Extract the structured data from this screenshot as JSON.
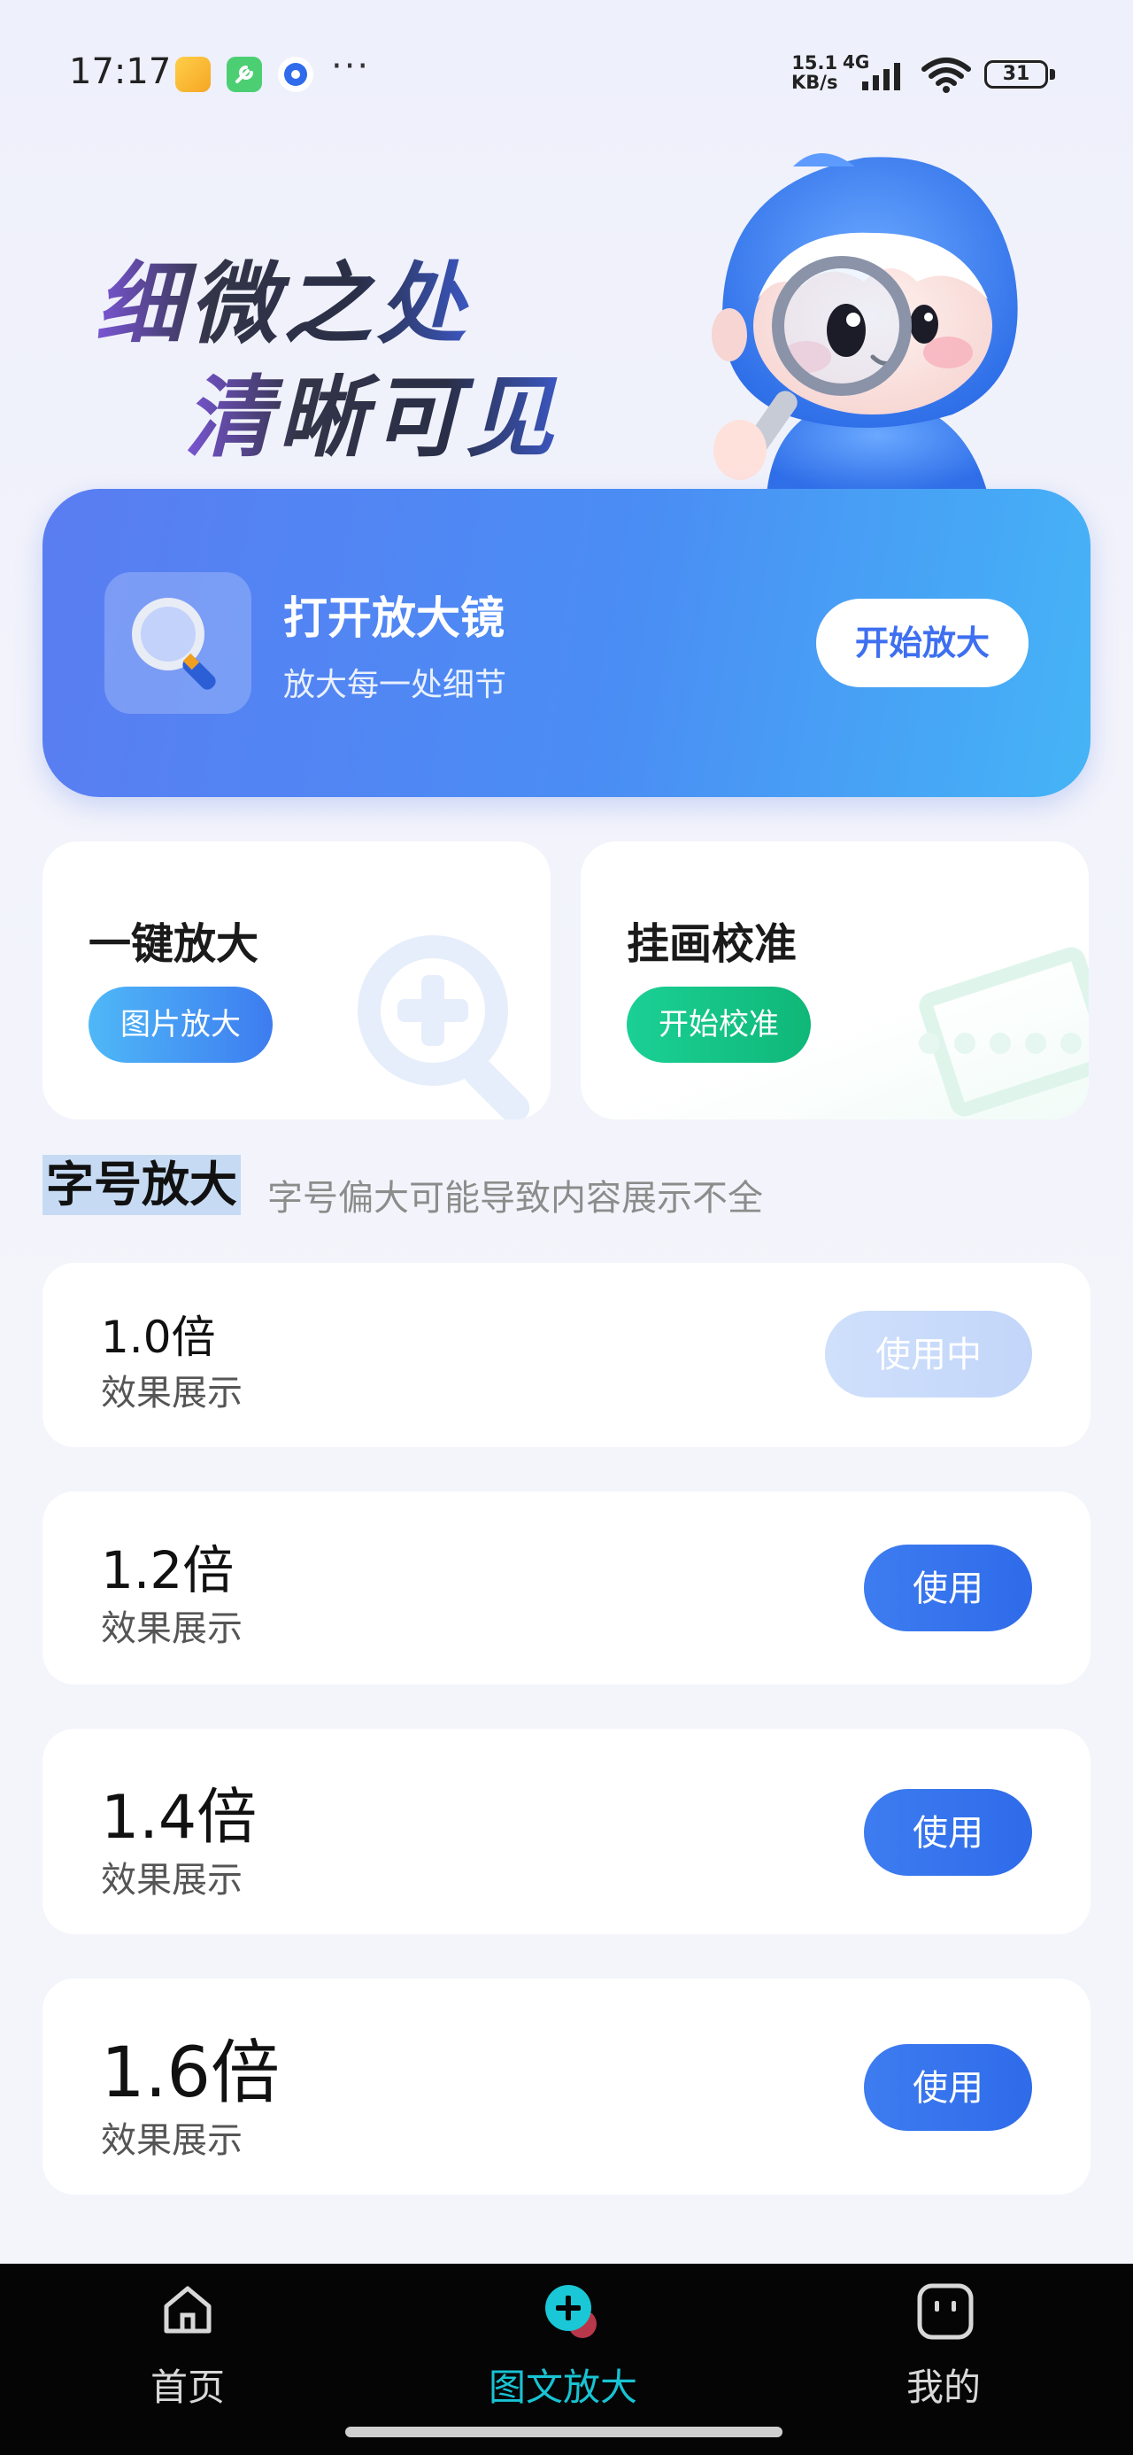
{
  "status_bar": {
    "time": "17:17",
    "more": "···",
    "net_speed_value": "15.1",
    "net_speed_unit": "KB/s",
    "network": "4G",
    "battery": "31"
  },
  "hero": {
    "line1": "细微之处",
    "line2": "清晰可见"
  },
  "magnifier_banner": {
    "title": "打开放大镜",
    "subtitle": "放大每一处细节",
    "button": "开始放大"
  },
  "cards": [
    {
      "title": "一键放大",
      "button": "图片放大"
    },
    {
      "title": "挂画校准",
      "button": "开始校准"
    }
  ],
  "font_scale": {
    "title": "字号放大",
    "note": "字号偏大可能导致内容展示不全",
    "options": [
      {
        "scale": "1.0倍",
        "effect": "效果展示",
        "button": "使用中",
        "active": true
      },
      {
        "scale": "1.2倍",
        "effect": "效果展示",
        "button": "使用",
        "active": false
      },
      {
        "scale": "1.4倍",
        "effect": "效果展示",
        "button": "使用",
        "active": false
      },
      {
        "scale": "1.6倍",
        "effect": "效果展示",
        "button": "使用",
        "active": false
      }
    ]
  },
  "bottom_nav": {
    "items": [
      {
        "label": "首页",
        "icon": "home-icon",
        "active": false
      },
      {
        "label": "图文放大",
        "icon": "zoom-plus-icon",
        "active": true
      },
      {
        "label": "我的",
        "icon": "profile-face-icon",
        "active": false
      }
    ]
  },
  "colors": {
    "accent_blue": "#3d7cf0",
    "accent_green": "#0fb778",
    "active_nav": "#18c3d3"
  }
}
